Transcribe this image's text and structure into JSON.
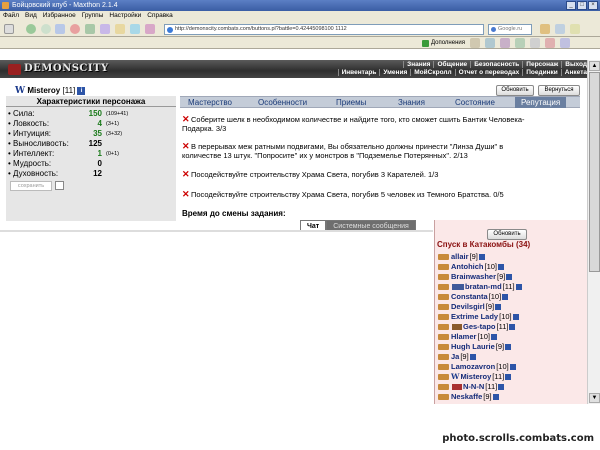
{
  "window": {
    "title": "Бойцовский клуб - Maxthon 2.1.4"
  },
  "menu": [
    "Файл",
    "Вид",
    "Избранное",
    "Группы",
    "Настройки",
    "Справка"
  ],
  "address": {
    "url": "http://demonscity.combats.com/buttons.pl?battle=0.42445098100 1112"
  },
  "search": {
    "placeholder": "Google.ru"
  },
  "addons": {
    "label": "Дополнения"
  },
  "game": {
    "logo": "DEMONSCITY",
    "nav_top": [
      "Знания",
      "Общение",
      "Безопасность",
      "Персонаж",
      "Выход"
    ],
    "nav_bottom": [
      "Инвентарь",
      "Умения",
      "МойСкролл",
      "Отчет о переводах",
      "Поединки",
      "Анкета"
    ]
  },
  "character": {
    "name": "Misteroy",
    "level": "[11]"
  },
  "buttons": {
    "refresh": "Обновить",
    "return": "Вернуться",
    "refresh2": "Обновить"
  },
  "stats": {
    "title": "Характеристики персонажа",
    "items": [
      {
        "label": "Сила:",
        "value": "150",
        "bonus": "(109+41)",
        "color": "#1a7a1a"
      },
      {
        "label": "Ловкость:",
        "value": "4",
        "bonus": "(3+1)",
        "color": "#1a7a1a"
      },
      {
        "label": "Интуиция:",
        "value": "35",
        "bonus": "(3+32)",
        "color": "#1a7a1a"
      },
      {
        "label": "Выносливость:",
        "value": "125",
        "bonus": "",
        "color": "#000000"
      },
      {
        "label": "Интеллект:",
        "value": "1",
        "bonus": "(0+1)",
        "color": "#1a7a1a"
      },
      {
        "label": "Мудрость:",
        "value": "0",
        "bonus": "",
        "color": "#000000"
      },
      {
        "label": "Духовность:",
        "value": "12",
        "bonus": "",
        "color": "#000000"
      }
    ],
    "save": "сохранить"
  },
  "tabs": [
    "Мастерство",
    "Особенности",
    "Приемы",
    "Знания",
    "Состояние",
    "Репутация"
  ],
  "quests": [
    {
      "line1": "Соберите шелк в необходимом количестве и найдите того, кто сможет сшить Бантик Человека-",
      "line2": "Подарка. 3/3"
    },
    {
      "line1": "В перерывах меж ратными подвигами, Вы обязательно должны принести \"Линза Души\" в",
      "line2": "количестве 13 штук. \"Попросите\" их у монстров в \"Подземелье Потерянных\". 2/13"
    },
    {
      "line1": "Посодействуйте строительству Храма Света, погубив 3 Карателей. 1/3",
      "line2": ""
    },
    {
      "line1": "Посодействуйте строительству Храма Света, погубив 5 человек из Темного Братства. 0/5",
      "line2": ""
    }
  ],
  "timer": "Время до смены задания:",
  "chat_tabs": {
    "chat": "Чат",
    "system": "Системные сообщения"
  },
  "location": {
    "title": "Спуск в Катакомбы (34)"
  },
  "users": [
    {
      "name": "allair",
      "level": "[9]"
    },
    {
      "name": "Antohich",
      "level": "[10]"
    },
    {
      "name": "Brainwasher",
      "level": "[9]"
    },
    {
      "name": "bratan-md",
      "level": "[11]"
    },
    {
      "name": "Constanta",
      "level": "[10]"
    },
    {
      "name": "Devilsgirl",
      "level": "[9]"
    },
    {
      "name": "Extrime Lady",
      "level": "[10]"
    },
    {
      "name": "Ges-tapo",
      "level": "[11]"
    },
    {
      "name": "Hlamer",
      "level": "[10]"
    },
    {
      "name": "Hugh Laurie",
      "level": "[9]"
    },
    {
      "name": "Ja",
      "level": "[9]"
    },
    {
      "name": "Lamozavron",
      "level": "[10]"
    },
    {
      "name": "Misteroy",
      "level": "[11]"
    },
    {
      "name": "N-N-N",
      "level": "[11]"
    },
    {
      "name": "Neskaffe",
      "level": "[9]"
    }
  ],
  "watermark": "photo.scrolls.combats.com"
}
